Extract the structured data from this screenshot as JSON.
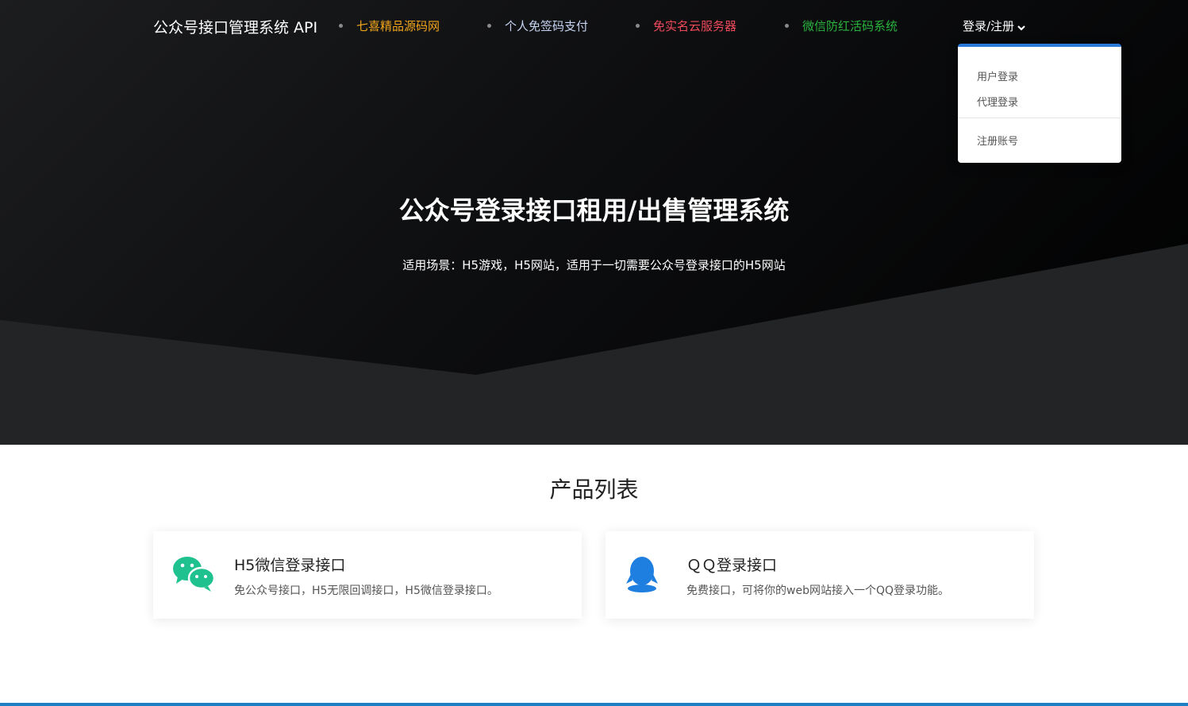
{
  "nav": {
    "brand": "公众号接口管理系统 API",
    "links": [
      {
        "label": "七喜精品源码网",
        "color": "#f0a41c"
      },
      {
        "label": "个人免签码支付",
        "color": "#c7d4f2"
      },
      {
        "label": "免实名云服务器",
        "color": "#f04a5b"
      },
      {
        "label": "微信防红活码系统",
        "color": "#2ab33e"
      }
    ],
    "login": {
      "label": "登录/注册",
      "icon": "chevron-down-icon",
      "menu": {
        "items": [
          "用户登录",
          "代理登录"
        ],
        "footer_item": "注册账号"
      }
    }
  },
  "hero": {
    "title": "公众号登录接口租用/出售管理系统",
    "subtitle": "适用场景：H5游戏，H5网站，适用于一切需要公众号登录接口的H5网站"
  },
  "products": {
    "title": "产品列表",
    "items": [
      {
        "icon": "wechat-icon",
        "title": "H5微信登录接口",
        "desc": "免公众号接口，H5无限回调接口，H5微信登录接口。",
        "accent": "#1fc28f"
      },
      {
        "icon": "qq-icon",
        "title": "ＱＱ登录接口",
        "desc": "免费接口，可将你的web网站接入一个QQ登录功能。",
        "accent": "#1f7fe0"
      }
    ]
  },
  "colors": {
    "accent_blue": "#2a7ad8",
    "bottom_bar": "#1c7fc4"
  }
}
